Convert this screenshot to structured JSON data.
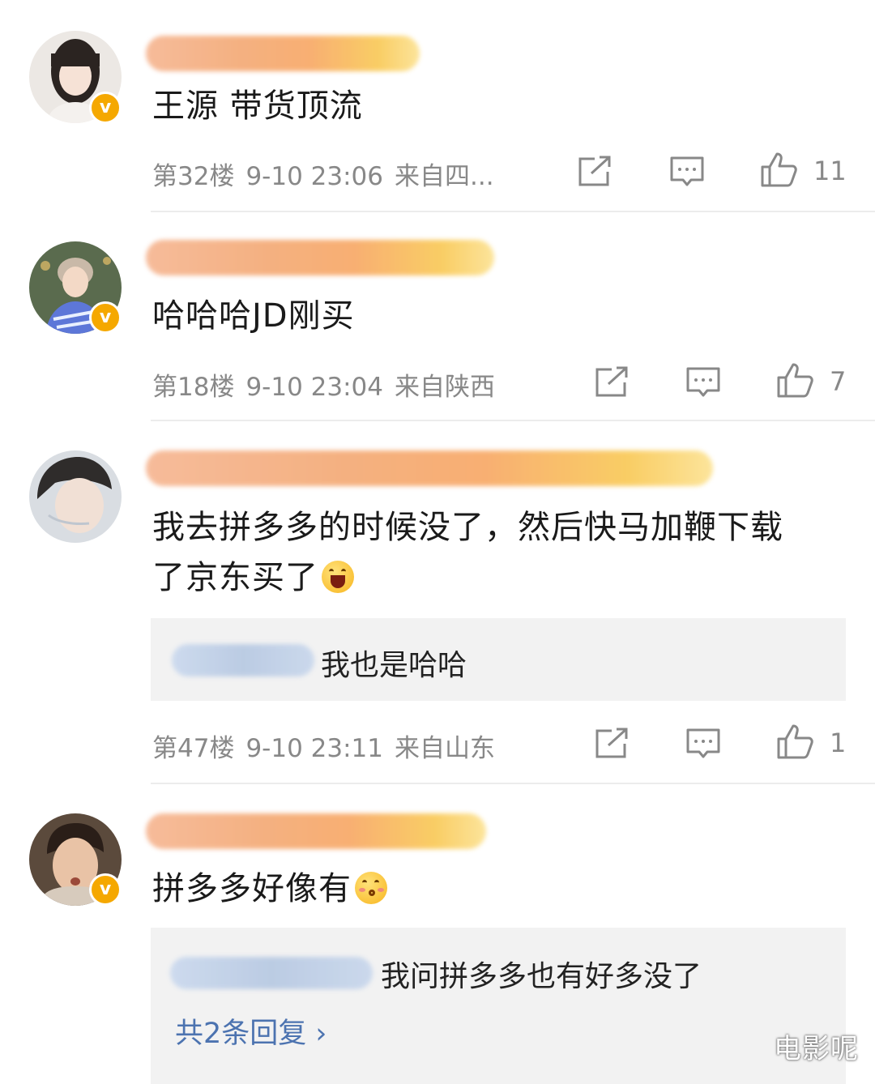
{
  "comments": [
    {
      "text": "王源 带货顶流",
      "floor": "第32楼",
      "time": "9-10 23:06",
      "location": "来自四...",
      "likes": "11",
      "verified": true
    },
    {
      "text": "哈哈哈JD刚买",
      "floor": "第18楼",
      "time": "9-10 23:04",
      "location": "来自陕西",
      "likes": "7",
      "verified": true
    },
    {
      "text_line1": "我去拼多多的时候没了，然后快马加鞭下载",
      "text_line2": "了京东买了",
      "emoji": "laughing-face",
      "reply": {
        "text": "我也是哈哈"
      },
      "floor": "第47楼",
      "time": "9-10 23:11",
      "location": "来自山东",
      "likes": "1",
      "verified": false
    },
    {
      "text": "拼多多好像有",
      "emoji": "kissing-face",
      "reply": {
        "text": "我问拼多多也有好多没了",
        "more": "共2条回复 ›"
      },
      "verified": true
    }
  ],
  "watermark": "电影呢",
  "colors": {
    "verified_badge": "#f5a800",
    "meta_text": "#888888",
    "reply_link": "#4c73b0",
    "reply_bg": "#f2f2f2"
  }
}
